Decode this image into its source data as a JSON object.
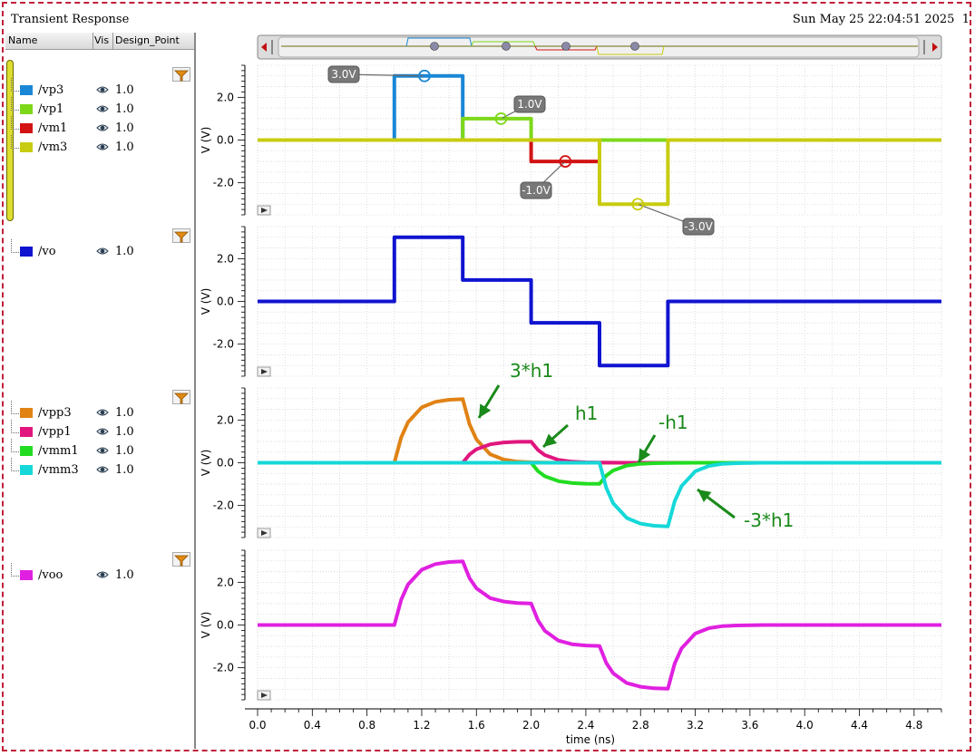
{
  "window": {
    "title": "Transient Response",
    "timestamp": "Sun May 25 22:04:51 2025",
    "edge_char": "1"
  },
  "sidebar": {
    "columns": [
      "Name",
      "Vis",
      "Design_Point"
    ],
    "groups": [
      {
        "signals": [
          {
            "name": "/vp3",
            "color": "#1a87d6",
            "design_point": "1.0"
          },
          {
            "name": "/vp1",
            "color": "#7ed81a",
            "design_point": "1.0"
          },
          {
            "name": "/vm1",
            "color": "#d21414",
            "design_point": "1.0"
          },
          {
            "name": "/vm3",
            "color": "#c8cc10",
            "design_point": "1.0"
          }
        ]
      },
      {
        "signals": [
          {
            "name": "/vo",
            "color": "#1014d0",
            "design_point": "1.0"
          }
        ]
      },
      {
        "signals": [
          {
            "name": "/vpp3",
            "color": "#e08214",
            "design_point": "1.0"
          },
          {
            "name": "/vpp1",
            "color": "#e0167e",
            "design_point": "1.0"
          },
          {
            "name": "/vmm1",
            "color": "#22dc22",
            "design_point": "1.0"
          },
          {
            "name": "/vmm3",
            "color": "#16d8d8",
            "design_point": "1.0"
          }
        ]
      },
      {
        "signals": [
          {
            "name": "/voo",
            "color": "#e020e0",
            "design_point": "1.0"
          }
        ]
      }
    ]
  },
  "markers": [
    "3.0V",
    "1.0V",
    "-1.0V",
    "-3.0V"
  ],
  "annotations": [
    "3*h1",
    "h1",
    "-h1",
    "-3*h1"
  ],
  "annotation_color": "#1a8a1a",
  "chart_data": [
    {
      "type": "line",
      "ylabel": "V (V)",
      "xlim": [
        0,
        5
      ],
      "ylim": [
        -3.5,
        3.5
      ],
      "yticks": [
        "2.0",
        "0.0",
        "-2.0"
      ],
      "series": [
        {
          "name": "/vp3",
          "x": [
            0,
            1.0,
            1.0,
            1.5,
            1.5,
            5.0
          ],
          "y": [
            0,
            0,
            3,
            3,
            0,
            0
          ]
        },
        {
          "name": "/vm1",
          "x": [
            0,
            2.0,
            2.0,
            2.5,
            2.5,
            3.0,
            3.0,
            5.0
          ],
          "y": [
            0,
            0,
            -1,
            -1,
            0,
            0,
            0,
            0
          ]
        },
        {
          "name": "/vp1",
          "x": [
            0,
            1.5,
            1.5,
            2.0,
            2.0,
            5.0
          ],
          "y": [
            0,
            0,
            1,
            1,
            0,
            0
          ]
        },
        {
          "name": "/vm3",
          "x": [
            0,
            2.5,
            2.5,
            3.0,
            3.0,
            5.0
          ],
          "y": [
            0,
            0,
            -3,
            -3,
            0,
            0
          ]
        }
      ]
    },
    {
      "type": "line",
      "ylabel": "V (V)",
      "xlim": [
        0,
        5
      ],
      "ylim": [
        -3.5,
        3.5
      ],
      "yticks": [
        "2.0",
        "0.0",
        "-2.0"
      ],
      "series": [
        {
          "name": "/vo",
          "x": [
            0,
            1.0,
            1.0,
            1.5,
            1.5,
            2.0,
            2.0,
            2.5,
            2.5,
            3.0,
            3.0,
            5.0
          ],
          "y": [
            0,
            0,
            3,
            3,
            1,
            1,
            -1,
            -1,
            -3,
            -3,
            0,
            0
          ]
        }
      ]
    },
    {
      "type": "line",
      "ylabel": "V (V)",
      "xlim": [
        0,
        5
      ],
      "ylim": [
        -3.5,
        3.5
      ],
      "yticks": [
        "2.0",
        "0.0",
        "-2.0"
      ],
      "series": [
        {
          "name": "/vpp3",
          "x": [
            0,
            1.0,
            1.05,
            1.1,
            1.2,
            1.3,
            1.4,
            1.5,
            1.55,
            1.6,
            1.7,
            1.8,
            1.9,
            2.0,
            2.2,
            5.0
          ],
          "y": [
            0,
            0,
            1.18,
            1.9,
            2.59,
            2.85,
            2.95,
            2.98,
            1.8,
            1.09,
            0.4,
            0.15,
            0.05,
            0.02,
            0,
            0
          ]
        },
        {
          "name": "/vpp1",
          "x": [
            0,
            1.5,
            1.55,
            1.6,
            1.7,
            1.8,
            1.9,
            2.0,
            2.05,
            2.1,
            2.2,
            2.3,
            2.4,
            2.5,
            2.7,
            5.0
          ],
          "y": [
            0,
            0,
            0.39,
            0.63,
            0.86,
            0.95,
            0.98,
            0.99,
            0.6,
            0.36,
            0.13,
            0.05,
            0.02,
            0.01,
            0,
            0
          ]
        },
        {
          "name": "/vmm1",
          "x": [
            0,
            2.0,
            2.05,
            2.1,
            2.2,
            2.3,
            2.4,
            2.5,
            2.55,
            2.6,
            2.7,
            2.8,
            2.9,
            3.0,
            3.2,
            5.0
          ],
          "y": [
            0,
            0,
            -0.39,
            -0.63,
            -0.86,
            -0.95,
            -0.98,
            -0.99,
            -0.6,
            -0.36,
            -0.13,
            -0.05,
            -0.02,
            -0.01,
            0,
            0
          ]
        },
        {
          "name": "/vmm3",
          "x": [
            0,
            2.5,
            2.55,
            2.6,
            2.7,
            2.8,
            2.9,
            3.0,
            3.05,
            3.1,
            3.2,
            3.3,
            3.4,
            3.5,
            3.7,
            5.0
          ],
          "y": [
            0,
            0,
            -1.18,
            -1.9,
            -2.59,
            -2.85,
            -2.95,
            -2.98,
            -1.8,
            -1.09,
            -0.4,
            -0.15,
            -0.05,
            -0.02,
            0,
            0
          ]
        }
      ]
    },
    {
      "type": "line",
      "ylabel": "V (V)",
      "xlabel": "time (ns)",
      "xlim": [
        0,
        5
      ],
      "ylim": [
        -3.5,
        3.5
      ],
      "yticks": [
        "2.0",
        "0.0",
        "-2.0"
      ],
      "xticks": [
        "0.0",
        "0.4",
        "0.8",
        "1.2",
        "1.6",
        "2.0",
        "2.4",
        "2.8",
        "3.2",
        "3.6",
        "4.0",
        "4.4",
        "4.8"
      ],
      "series": [
        {
          "name": "/voo",
          "x": [
            0,
            1.0,
            1.05,
            1.1,
            1.2,
            1.3,
            1.4,
            1.5,
            1.55,
            1.6,
            1.7,
            1.8,
            1.9,
            2.0,
            2.05,
            2.1,
            2.2,
            2.3,
            2.4,
            2.5,
            2.55,
            2.6,
            2.7,
            2.8,
            2.9,
            3.0,
            3.05,
            3.1,
            3.2,
            3.3,
            3.4,
            3.5,
            3.7,
            5.0
          ],
          "y": [
            0,
            0,
            1.18,
            1.9,
            2.59,
            2.85,
            2.95,
            2.98,
            2.19,
            1.72,
            1.26,
            1.1,
            1.03,
            1.01,
            0.22,
            -0.27,
            -0.73,
            -0.9,
            -0.96,
            -0.98,
            -1.78,
            -2.26,
            -2.72,
            -2.89,
            -2.96,
            -2.98,
            -1.8,
            -1.09,
            -0.4,
            -0.15,
            -0.05,
            -0.02,
            0,
            0
          ]
        }
      ]
    }
  ]
}
